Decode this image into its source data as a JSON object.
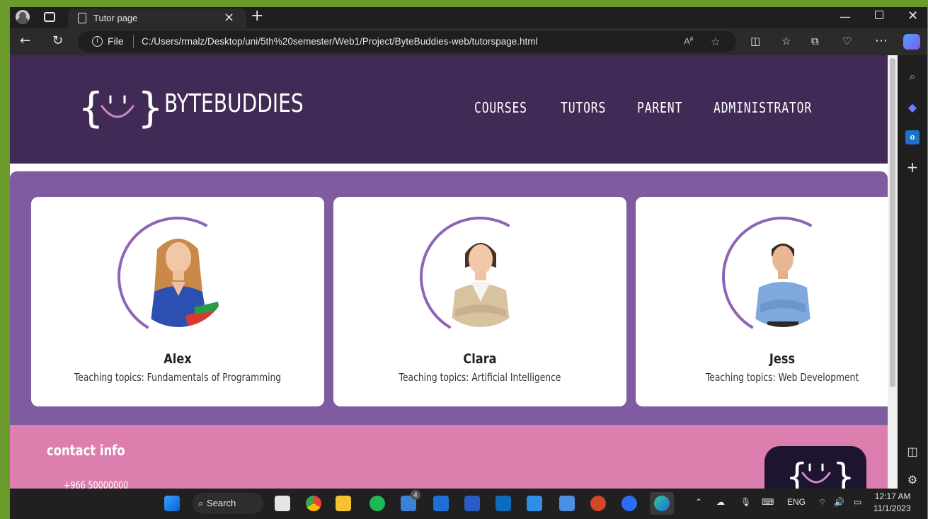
{
  "browser": {
    "tab_title": "Tutor page",
    "address_prefix": "File",
    "url": "C:/Users/rmalz/Desktop/uni/5th%20semester/Web1/Project/ByteBuddies-web/tutorspage.html"
  },
  "site": {
    "brand": "BYTEBUDDIES",
    "nav": [
      "COURSES",
      "TUTORS",
      "PARENT",
      "ADMINISTRATOR"
    ]
  },
  "tutors": [
    {
      "name": "Alex",
      "topic": "Teaching topics: Fundamentals of Programming"
    },
    {
      "name": "Clara",
      "topic": "Teaching topics: Artificial Intelligence"
    },
    {
      "name": "Jess",
      "topic": "Teaching topics: Web Development"
    }
  ],
  "footer": {
    "title": "contact info",
    "phone": "+966 50000000"
  },
  "taskbar": {
    "search_label": "Search",
    "language": "ENG",
    "time": "12:17 AM",
    "date": "11/1/2023",
    "badge_count": "4"
  },
  "colors": {
    "header_bg": "#412a55",
    "tutors_bg": "#7f5b9f",
    "footer_bg": "#dc7eae",
    "accent_ring": "#8e64b5"
  }
}
